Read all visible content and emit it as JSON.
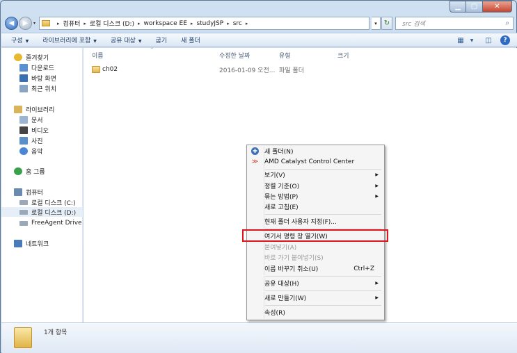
{
  "window": {
    "min_glyph": "▁",
    "max_glyph": "▢",
    "close_glyph": "✕"
  },
  "nav": {
    "back_glyph": "◀",
    "forward_glyph": "▶",
    "dropdown_glyph": "▾",
    "breadcrumbs": [
      "컴퓨터",
      "로컬 디스크 (D:)",
      "workspace EE",
      "studyJSP",
      "src"
    ],
    "separator": "▸",
    "refresh_glyph": "↻",
    "search_placeholder": "src 검색",
    "search_glyph": "⌕"
  },
  "toolbar": {
    "items": [
      "구성",
      "라이브러리에 포함",
      "공유 대상",
      "굽기",
      "새 폴더"
    ],
    "arrow": "▼",
    "view_glyph": "▦",
    "pane_glyph": "◫",
    "help_glyph": "?"
  },
  "sidebar": {
    "items": [
      {
        "label": "즐겨찾기",
        "color": "#e8b830"
      },
      {
        "label": "다운로드",
        "color": "#5a8fd0"
      },
      {
        "label": "바탕 화면",
        "color": "#3a6fb0"
      },
      {
        "label": "최근 위치",
        "color": "#8aa4c4"
      },
      {
        "label": "라이브러리",
        "color": "#d9b45a"
      },
      {
        "label": "문서",
        "color": "#9bb4d2"
      },
      {
        "label": "비디오",
        "color": "#444444"
      },
      {
        "label": "사진",
        "color": "#5d8fc7"
      },
      {
        "label": "음악",
        "color": "#4a86d4"
      },
      {
        "label": "홈 그룹",
        "color": "#3aa04a"
      },
      {
        "label": "컴퓨터",
        "color": "#6a8ab0"
      },
      {
        "label": "로컬 디스크 (C:)",
        "color": "#9aa8b8"
      },
      {
        "label": "로컬 디스크 (D:)",
        "color": "#9aa8b8"
      },
      {
        "label": "FreeAgent Drive (F:)",
        "color": "#9aa8b8"
      },
      {
        "label": "네트워크",
        "color": "#4a7ab8"
      }
    ]
  },
  "content": {
    "columns": [
      "이름",
      "수정한 날짜",
      "유형",
      "크기"
    ],
    "sort_glyph": "^",
    "rows": [
      {
        "name": "ch02",
        "date": "2016-01-09 오전...",
        "type": "파일 폴더",
        "size": ""
      }
    ]
  },
  "details": {
    "count": "1개 항목"
  },
  "context_menu": {
    "items": [
      {
        "label": "새 폴더(N)",
        "icon": "new-folder"
      },
      {
        "label": "AMD Catalyst Control Center",
        "icon": "amd"
      },
      {
        "label": "보기(V)",
        "submenu": true
      },
      {
        "label": "정렬 기준(O)",
        "submenu": true
      },
      {
        "label": "묶는 방법(P)",
        "submenu": true
      },
      {
        "label": "새로 고침(E)"
      },
      {
        "label": "현재 폴더 사용자 지정(F)..."
      },
      {
        "label": "여기서 명령 창 열기(W)"
      },
      {
        "label": "붙여넣기(A)",
        "disabled": true
      },
      {
        "label": "바로 가기 붙여넣기(S)",
        "disabled": true
      },
      {
        "label": "이름 바꾸기 취소(U)",
        "shortcut": "Ctrl+Z"
      },
      {
        "label": "공유 대상(H)",
        "submenu": true
      },
      {
        "label": "새로 만들기(W)",
        "submenu": true
      },
      {
        "label": "속성(R)"
      }
    ],
    "submenu_glyph": "▶",
    "new_folder_glyph": "✚",
    "amd_glyph": "≫",
    "highlight_color": "#e0151b"
  }
}
